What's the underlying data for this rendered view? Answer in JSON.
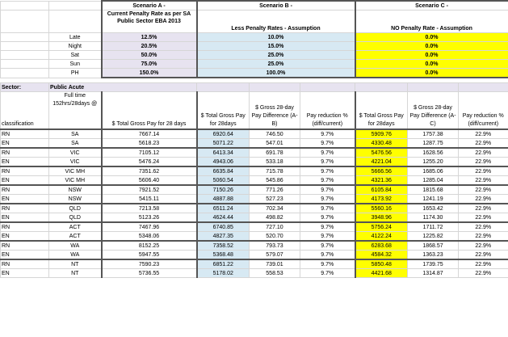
{
  "scenarios": {
    "a_title": "Scenario A -",
    "a_desc": "Current Penalty Rate as per SA Public Sector EBA 2013",
    "b_title": "Scenario B -",
    "b_desc": "Less Penalty Rates - Assumption",
    "c_title": "Scenario C -",
    "c_desc": "NO Penalty Rate - Assumption"
  },
  "rates": [
    {
      "label": "Late",
      "a": "12.5%",
      "b": "10.0%",
      "c": "0.0%"
    },
    {
      "label": "Night",
      "a": "20.5%",
      "b": "15.0%",
      "c": "0.0%"
    },
    {
      "label": "Sat",
      "a": "50.0%",
      "b": "25.0%",
      "c": "0.0%"
    },
    {
      "label": "Sun",
      "a": "75.0%",
      "b": "25.0%",
      "c": "0.0%"
    },
    {
      "label": "PH",
      "a": "150.0%",
      "b": "100.0%",
      "c": "0.0%"
    }
  ],
  "sector": {
    "label": "Sector:",
    "value": "Public Acute"
  },
  "columns": {
    "classification": "classification",
    "fulltime": "Full time 152hrs/28days @",
    "total_a": "$ Total Gross Pay for 28 days",
    "total_b": "$ Total Gross Pay for 28days",
    "diff_b": "$ Gross 28-day Pay Difference (A-B)",
    "red_b": "Pay reduction % (diff/current)",
    "total_c": "$ Total Gross Pay for 28days",
    "diff_c": "$ Gross 28-day Pay Difference (A-C)",
    "red_c": "Pay reduction % (diff/current)"
  },
  "rows": [
    {
      "cls": "RN",
      "state": "SA",
      "a": "7667.14",
      "b": "6920.64",
      "db": "746.50",
      "rb": "9.7%",
      "c": "5909.76",
      "dc": "1757.38",
      "rc": "22.9%"
    },
    {
      "cls": "EN",
      "state": "SA",
      "a": "5618.23",
      "b": "5071.22",
      "db": "547.01",
      "rb": "9.7%",
      "c": "4330.48",
      "dc": "1287.75",
      "rc": "22.9%"
    },
    {
      "cls": "RN",
      "state": "VIC",
      "a": "7105.12",
      "b": "6413.34",
      "db": "691.78",
      "rb": "9.7%",
      "c": "5476.56",
      "dc": "1628.56",
      "rc": "22.9%"
    },
    {
      "cls": "EN",
      "state": "VIC",
      "a": "5476.24",
      "b": "4943.06",
      "db": "533.18",
      "rb": "9.7%",
      "c": "4221.04",
      "dc": "1255.20",
      "rc": "22.9%"
    },
    {
      "cls": "RN",
      "state": "VIC MH",
      "a": "7351.62",
      "b": "6635.84",
      "db": "715.78",
      "rb": "9.7%",
      "c": "5666.56",
      "dc": "1685.06",
      "rc": "22.9%"
    },
    {
      "cls": "EN",
      "state": "VIC MH",
      "a": "5606.40",
      "b": "5060.54",
      "db": "545.86",
      "rb": "9.7%",
      "c": "4321.36",
      "dc": "1285.04",
      "rc": "22.9%"
    },
    {
      "cls": "RN",
      "state": "NSW",
      "a": "7921.52",
      "b": "7150.26",
      "db": "771.26",
      "rb": "9.7%",
      "c": "6105.84",
      "dc": "1815.68",
      "rc": "22.9%"
    },
    {
      "cls": "EN",
      "state": "NSW",
      "a": "5415.11",
      "b": "4887.88",
      "db": "527.23",
      "rb": "9.7%",
      "c": "4173.92",
      "dc": "1241.19",
      "rc": "22.9%"
    },
    {
      "cls": "RN",
      "state": "QLD",
      "a": "7213.58",
      "b": "6511.24",
      "db": "702.34",
      "rb": "9.7%",
      "c": "5560.16",
      "dc": "1653.42",
      "rc": "22.9%"
    },
    {
      "cls": "EN",
      "state": "QLD",
      "a": "5123.26",
      "b": "4624.44",
      "db": "498.82",
      "rb": "9.7%",
      "c": "3948.96",
      "dc": "1174.30",
      "rc": "22.9%"
    },
    {
      "cls": "RN",
      "state": "ACT",
      "a": "7467.96",
      "b": "6740.85",
      "db": "727.10",
      "rb": "9.7%",
      "c": "5756.24",
      "dc": "1711.72",
      "rc": "22.9%"
    },
    {
      "cls": "EN",
      "state": "ACT",
      "a": "5348.06",
      "b": "4827.35",
      "db": "520.70",
      "rb": "9.7%",
      "c": "4122.24",
      "dc": "1225.82",
      "rc": "22.9%"
    },
    {
      "cls": "RN",
      "state": "WA",
      "a": "8152.25",
      "b": "7358.52",
      "db": "793.73",
      "rb": "9.7%",
      "c": "6283.68",
      "dc": "1868.57",
      "rc": "22.9%"
    },
    {
      "cls": "EN",
      "state": "WA",
      "a": "5947.55",
      "b": "5368.48",
      "db": "579.07",
      "rb": "9.7%",
      "c": "4584.32",
      "dc": "1363.23",
      "rc": "22.9%"
    },
    {
      "cls": "RN",
      "state": "NT",
      "a": "7590.23",
      "b": "6851.22",
      "db": "739.01",
      "rb": "9.7%",
      "c": "5850.48",
      "dc": "1739.75",
      "rc": "22.9%"
    },
    {
      "cls": "EN",
      "state": "NT",
      "a": "5736.55",
      "b": "5178.02",
      "db": "558.53",
      "rb": "9.7%",
      "c": "4421.68",
      "dc": "1314.87",
      "rc": "22.9%"
    }
  ],
  "colors": {
    "lavender": "#e7e3f0",
    "blue": "#d7e9f3",
    "yellow": "#ffff00"
  }
}
